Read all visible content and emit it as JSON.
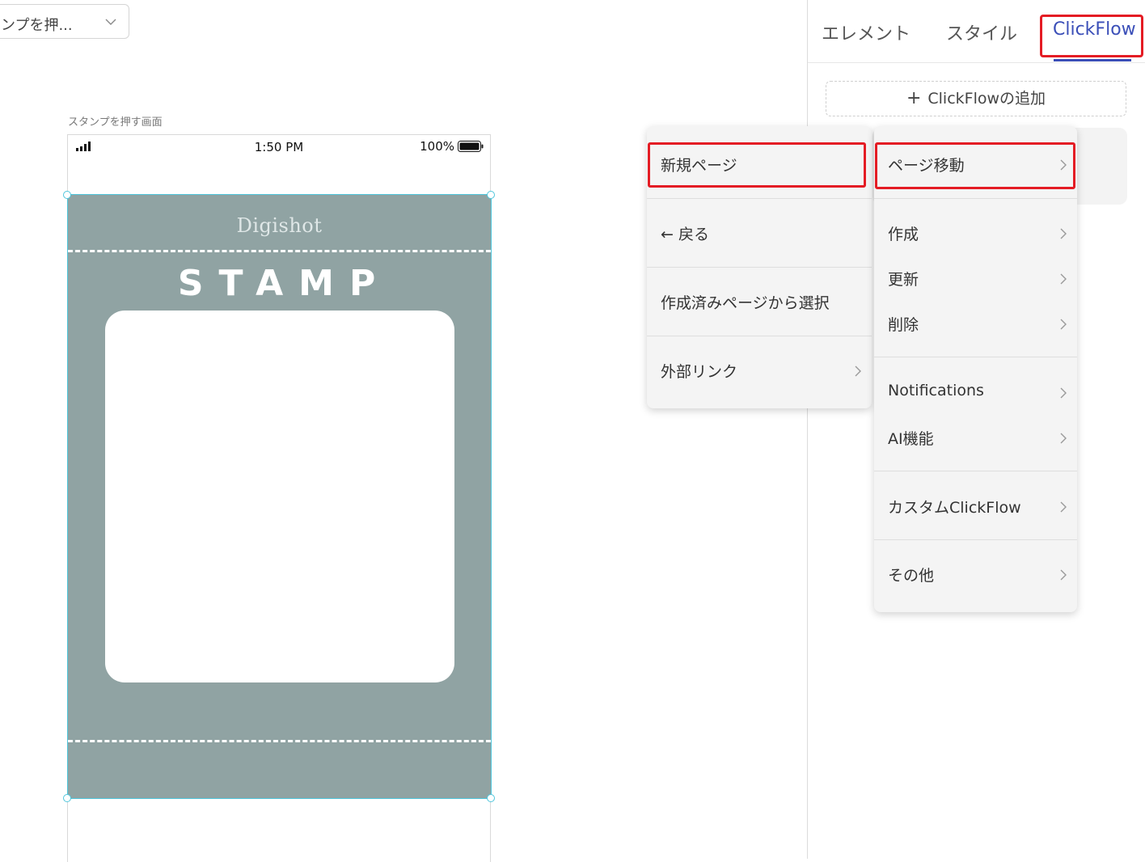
{
  "page_selector": {
    "value": "ンプを押..."
  },
  "canvas": {
    "screen_label": "スタンプを押す画面",
    "status_bar": {
      "time": "1:50 PM",
      "battery": "100%"
    },
    "card": {
      "logo": "Digishot",
      "title": "STAMP"
    }
  },
  "right_panel": {
    "tabs": [
      {
        "label": "エレメント"
      },
      {
        "label": "スタイル"
      },
      {
        "label": "ClickFlow",
        "active": true
      }
    ],
    "add_button": {
      "icon": "plus-icon",
      "label": "ClickFlowの追加"
    }
  },
  "menu_main": {
    "items": [
      {
        "label": "新規ページ",
        "highlighted": true
      },
      {
        "label": "← 戻る"
      },
      {
        "label": "作成済みページから選択"
      },
      {
        "label": "外部リンク",
        "has_submenu": true
      }
    ]
  },
  "menu_sub": {
    "items": [
      {
        "label": "ページ移動",
        "highlighted": true
      },
      {
        "label": "作成"
      },
      {
        "label": "更新"
      },
      {
        "label": "削除"
      },
      {
        "label": "Notifications"
      },
      {
        "label": "AI機能"
      },
      {
        "label": "カスタムClickFlow"
      },
      {
        "label": "その他"
      }
    ]
  },
  "colors": {
    "accent": "#3b4fb8",
    "highlight_box": "#e41c24",
    "card_background": "#90a3a3",
    "selection": "#4fc6dc"
  }
}
